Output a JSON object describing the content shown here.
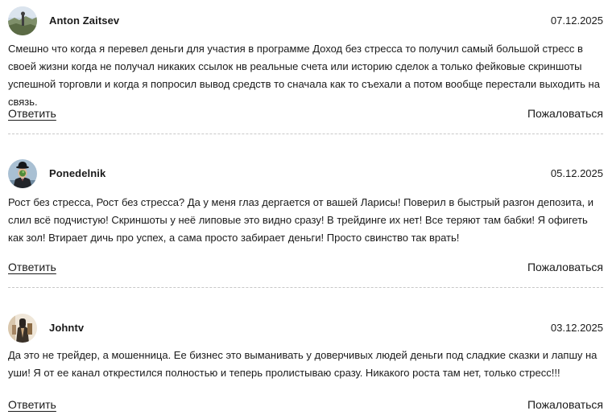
{
  "comments": [
    {
      "author": "Anton Zaitsev",
      "date": "07.12.2025",
      "avatar_icon": "landscape-photo-avatar",
      "text": "Смешно что когда я перевел деньги для участия в программе Доход без стресса то получил самый большой стресс в своей жизни когда не получал никаких ссылок нв реальные счета или историю сделок а только фейковые скриншоты успешной торговли и когда я попросил вывод средств то сначала как то съехали а потом вообще перестали выходить на связь.",
      "reply_label": "Ответить",
      "report_label": "Пожаловаться"
    },
    {
      "author": "Ponedelnik",
      "date": "05.12.2025",
      "avatar_icon": "bowler-hat-man-avatar",
      "text": "Рост без стресса, Рост без стресса? Да у меня глаз дергается от вашей Ларисы! Поверил в быстрый разгон депозита, и слил всё подчистую! Скриншоты у неё липовые это видно сразу! В трейдинге их нет! Все теряют там бабки! Я офигеть как зол! Втирает дичь про успех, а сама просто забирает деньги! Просто свинство так врать!",
      "reply_label": "Ответить",
      "report_label": "Пожаловаться"
    },
    {
      "author": "Johntv",
      "date": "03.12.2025",
      "avatar_icon": "figure-photo-avatar",
      "text": "Да это не трейдер, а мошенница. Ее бизнес это выманивать у доверчивых людей деньги под сладкие сказки и лапшу на уши! Я от ее канал открестился полностью и теперь пролистываю сразу. Никакого роста там нет, только стресс!!!",
      "reply_label": "Ответить",
      "report_label": "Пожаловаться"
    }
  ]
}
